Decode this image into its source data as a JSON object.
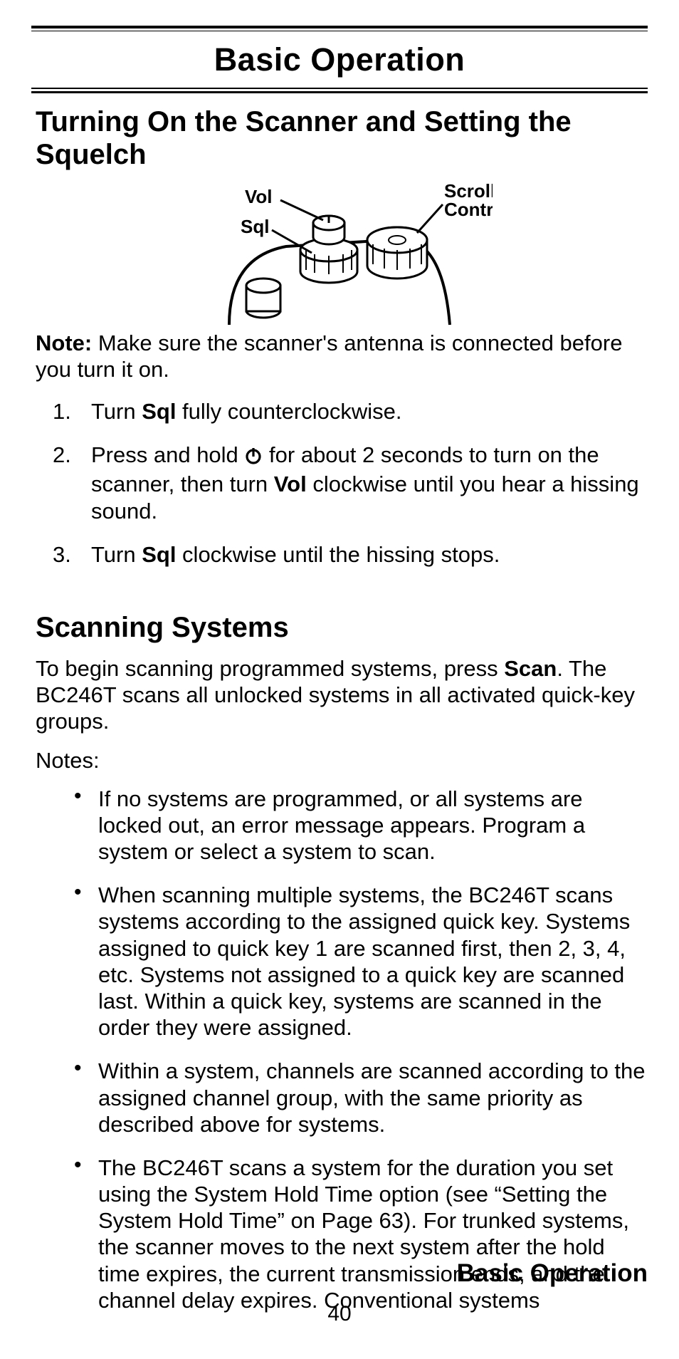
{
  "chapter_title": "Basic Operation",
  "section1": {
    "heading": "Turning On the Scanner and Setting the Squelch",
    "labels": {
      "vol": "Vol",
      "sql": "Sql",
      "scroll": "Scroll Control"
    },
    "note_label": "Note:",
    "note_text": " Make sure the scanner's antenna is connected before you turn it on.",
    "steps": {
      "s1_a": "Turn ",
      "s1_b": "Sql",
      "s1_c": " fully counterclockwise.",
      "s2_a": "Press and hold ",
      "s2_b": " for about 2 seconds to turn on the scanner, then turn ",
      "s2_c": "Vol",
      "s2_d": " clockwise until you hear a hiss­ing sound.",
      "s3_a": "Turn ",
      "s3_b": "Sql",
      "s3_c": " clockwise until the hissing stops."
    }
  },
  "section2": {
    "heading": "Scanning Systems",
    "intro_a": "To begin scanning programmed systems, press ",
    "intro_b": "Scan",
    "intro_c": ". The BC246T scans all unlocked systems in all activated quick-key groups.",
    "notes_label": "Notes:",
    "bullets": [
      "If no systems are programmed, or all systems are locked out, an error message appears. Program a system or select a system to scan.",
      "When scanning multiple systems, the BC246T scans systems according to the assigned quick key. Systems assigned to quick key 1 are scanned first, then 2, 3, 4, etc. Systems not assigned to a quick key are scanned last. Within a quick key, systems are scanned in the order they were assigned.",
      "Within a system, channels are scanned according to the assigned channel group, with the same priority as described above for systems.",
      "The BC246T scans a system for the duration you set using the System Hold Time option (see “Setting the System Hold Time” on Page 63). For trunked sys­tems, the scanner moves to the next system after the hold time expires, the current transmission ends, and the channel delay expires. Conventional systems"
    ]
  },
  "footer_label": "Basic Operation",
  "page_number": "40"
}
